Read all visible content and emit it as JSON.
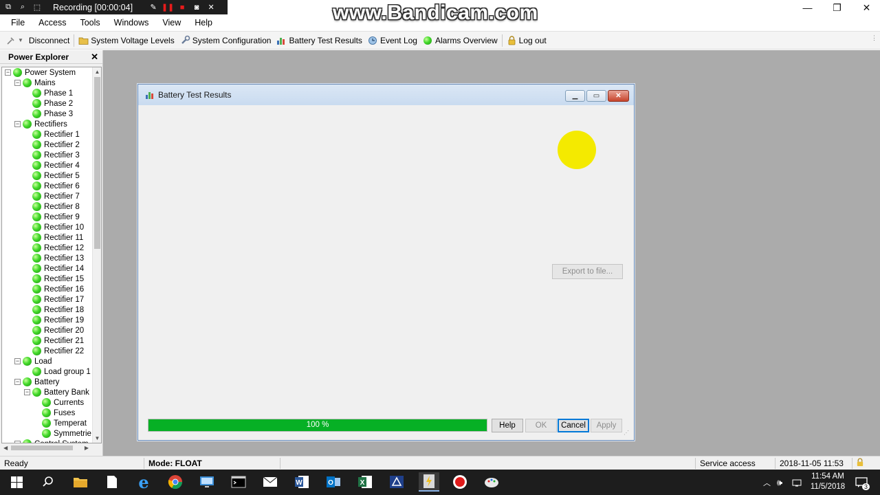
{
  "recording": {
    "label": "Recording [00:00:04]"
  },
  "watermark": "www.Bandicam.com",
  "menu": {
    "items": [
      "File",
      "Access",
      "Tools",
      "Windows",
      "View",
      "Help"
    ]
  },
  "toolbar": {
    "disconnect": "Disconnect",
    "voltage": "System Voltage Levels",
    "config": "System Configuration",
    "battery_test": "Battery Test Results",
    "event_log": "Event Log",
    "alarms": "Alarms Overview",
    "logout": "Log out"
  },
  "explorer": {
    "title": "Power Explorer",
    "close": "✕",
    "tree": [
      {
        "label": "Power System",
        "level": 0,
        "expander": "−"
      },
      {
        "label": "Mains",
        "level": 1,
        "expander": "−"
      },
      {
        "label": "Phase 1",
        "level": 2
      },
      {
        "label": "Phase 2",
        "level": 2
      },
      {
        "label": "Phase 3",
        "level": 2
      },
      {
        "label": "Rectifiers",
        "level": 1,
        "expander": "−"
      },
      {
        "label": "Rectifier 1",
        "level": 2
      },
      {
        "label": "Rectifier 2",
        "level": 2
      },
      {
        "label": "Rectifier 3",
        "level": 2
      },
      {
        "label": "Rectifier 4",
        "level": 2
      },
      {
        "label": "Rectifier 5",
        "level": 2
      },
      {
        "label": "Rectifier 6",
        "level": 2
      },
      {
        "label": "Rectifier 7",
        "level": 2
      },
      {
        "label": "Rectifier 8",
        "level": 2
      },
      {
        "label": "Rectifier 9",
        "level": 2
      },
      {
        "label": "Rectifier 10",
        "level": 2
      },
      {
        "label": "Rectifier 11",
        "level": 2
      },
      {
        "label": "Rectifier 12",
        "level": 2
      },
      {
        "label": "Rectifier 13",
        "level": 2
      },
      {
        "label": "Rectifier 14",
        "level": 2
      },
      {
        "label": "Rectifier 15",
        "level": 2
      },
      {
        "label": "Rectifier 16",
        "level": 2
      },
      {
        "label": "Rectifier 17",
        "level": 2
      },
      {
        "label": "Rectifier 18",
        "level": 2
      },
      {
        "label": "Rectifier 19",
        "level": 2
      },
      {
        "label": "Rectifier 20",
        "level": 2
      },
      {
        "label": "Rectifier 21",
        "level": 2
      },
      {
        "label": "Rectifier 22",
        "level": 2
      },
      {
        "label": "Load",
        "level": 1,
        "expander": "−"
      },
      {
        "label": "Load group 1",
        "level": 2
      },
      {
        "label": "Battery",
        "level": 1,
        "expander": "−"
      },
      {
        "label": "Battery Bank",
        "level": 2,
        "expander": "−"
      },
      {
        "label": "Currents",
        "level": 3
      },
      {
        "label": "Fuses",
        "level": 3
      },
      {
        "label": "Temperat",
        "level": 3
      },
      {
        "label": "Symmetrie",
        "level": 3
      },
      {
        "label": "Control System",
        "level": 1,
        "expander": "−"
      }
    ]
  },
  "dialog": {
    "title": "Battery Test Results",
    "export_label": "Export to file...",
    "progress_text": "100 %",
    "progress_fraction": 1.0,
    "help": "Help",
    "ok": "OK",
    "cancel": "Cancel",
    "apply": "Apply"
  },
  "status": {
    "ready": "Ready",
    "mode": "Mode: FLOAT",
    "access": "Service access",
    "datetime": "2018-11-05 11:53"
  },
  "taskbar": {
    "time": "11:54 AM",
    "date": "11/5/2018",
    "notif_count": "3"
  },
  "colors": {
    "progress": "#06b025",
    "accent": "#0078d7",
    "cursor_highlight": "#f4ea00"
  }
}
